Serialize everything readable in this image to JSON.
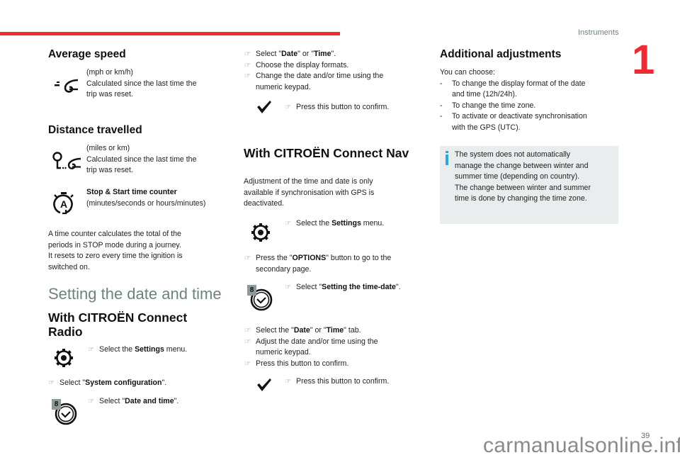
{
  "header": {
    "running_title": "Instruments",
    "chapter_number": "1",
    "accent_color": "#ee2a33"
  },
  "col1": {
    "avg_speed": {
      "title": "Average speed",
      "icon": "average-speed-icon",
      "line1": "(mph or km/h)",
      "line2": "Calculated since the last time the",
      "line3": "trip was reset."
    },
    "distance": {
      "title": "Distance travelled",
      "icon": "distance-travelled-icon",
      "line1": "(miles or km)",
      "line2": "Calculated since the last time the",
      "line3": "trip was reset."
    },
    "stop_start": {
      "icon": "stop-start-icon",
      "title": "Stop & Start time counter",
      "line1": "(minutes/seconds or hours/minutes)"
    },
    "para": [
      "A time counter calculates the total of the",
      "periods in STOP mode during a journey.",
      "It resets to zero every time the ignition is",
      "switched on."
    ],
    "section_title": "Setting the date and time",
    "radio_title_1": "With CITROËN Connect",
    "radio_title_2": "Radio",
    "step1": {
      "pre": "Select the ",
      "bold": "Settings",
      "post": " menu.",
      "icon": "settings-gear-icon"
    },
    "step2": {
      "pre": "Select \"",
      "bold": "System configuration",
      "post": "\"."
    },
    "step3": {
      "pre": "Select \"",
      "bold": "Date and time",
      "post": "\".",
      "icon": "clock-icon",
      "badge": "8"
    }
  },
  "col2": {
    "steps_a": [
      {
        "pre": "Select \"",
        "bold": "Date",
        "mid": "\" or \"",
        "bold2": "Time",
        "post": "\"."
      },
      {
        "text": "Choose the display formats."
      },
      {
        "line1": "Change the date and/or time using the",
        "line2": "numeric keypad."
      }
    ],
    "confirm1": {
      "text": "Press this button to confirm.",
      "icon": "checkmark-icon"
    },
    "nav_title": "With CITROËN Connect Nav",
    "nav_para": [
      "Adjustment of the time and date is only",
      "available if synchronisation with GPS is",
      "deactivated."
    ],
    "nav_step1": {
      "pre": "Select the ",
      "bold": "Settings",
      "post": " menu."
    },
    "nav_step2": {
      "pre": "Press the \"",
      "bold": "OPTIONS",
      "post": "\" button to go to the",
      "line2": "secondary page."
    },
    "nav_step3": {
      "pre": "Select \"",
      "bold": "Setting the time-date",
      "post": "\".",
      "badge": "8"
    },
    "steps_b": [
      {
        "pre": "Select the \"",
        "bold": "Date",
        "mid": "\" or \"",
        "bold2": "Time",
        "post": "\" tab."
      },
      {
        "line1": "Adjust the date and/or time using the",
        "line2": "numeric keypad."
      },
      {
        "text": "Press this button to confirm."
      }
    ],
    "confirm2": {
      "text": "Press this button to confirm."
    }
  },
  "col3": {
    "title": "Additional adjustments",
    "intro": "You can choose:",
    "items": [
      {
        "line1": "To change the display format of the date",
        "line2": "and time (12h/24h)."
      },
      {
        "line1": "To change the time zone."
      },
      {
        "line1": "To activate or deactivate synchronisation",
        "line2": "with the GPS (UTC)."
      }
    ],
    "note": [
      "The system does not automatically",
      "manage the change between winter and",
      "summer time (depending on country).",
      "The change between winter and summer",
      "time is done by changing the time zone."
    ],
    "note_icon_color": "#2aa7e0"
  },
  "footer": {
    "page_number": "39",
    "watermark": "carmanualsonline.info"
  },
  "glyphs": {
    "hand": "☞",
    "dash": "-"
  }
}
